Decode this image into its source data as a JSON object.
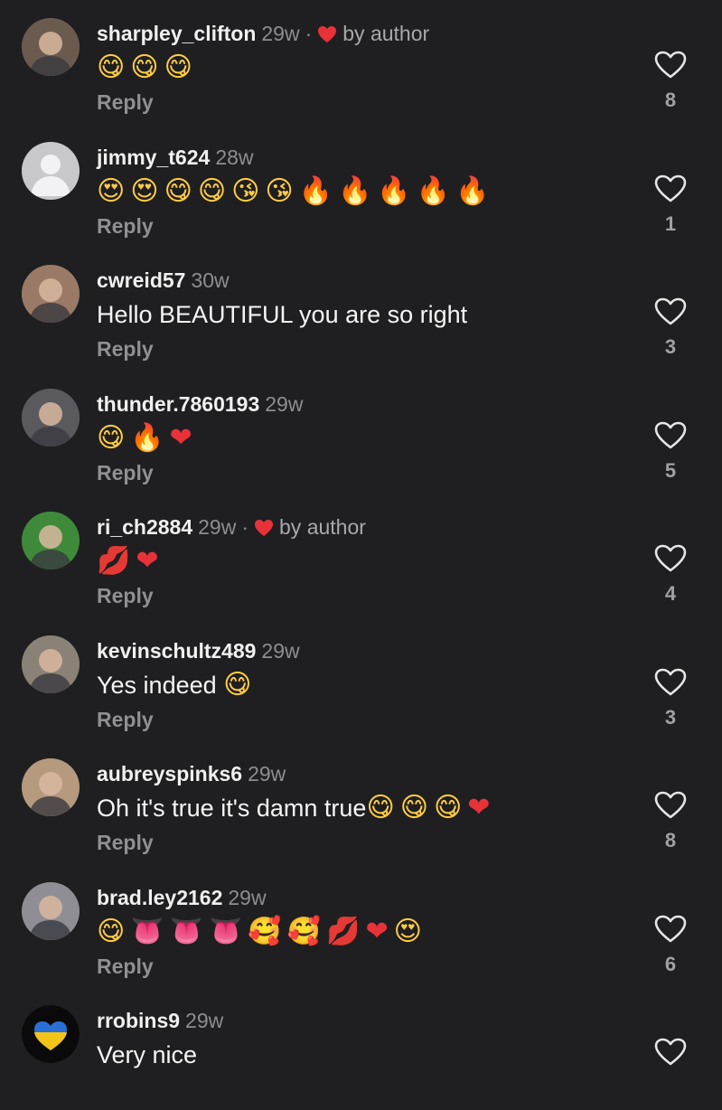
{
  "comments": [
    {
      "username": "sharpley_clifton",
      "time": "29w",
      "liked_by_author": true,
      "by_author_label": "by author",
      "text": "",
      "emojis": [
        {
          "char": "😋",
          "name": "yum-emoji",
          "tone": "yellow"
        },
        {
          "char": "😋",
          "name": "yum-emoji",
          "tone": "yellow"
        },
        {
          "char": "😋",
          "name": "yum-emoji",
          "tone": "yellow"
        }
      ],
      "reply_label": "Reply",
      "likes": "8",
      "avatar_color": "#6b5a4e"
    },
    {
      "username": "jimmy_t624",
      "time": "28w",
      "liked_by_author": false,
      "by_author_label": "",
      "text": "",
      "emojis": [
        {
          "char": "😍",
          "name": "heart-eyes-emoji",
          "tone": "yellow"
        },
        {
          "char": "😍",
          "name": "heart-eyes-emoji",
          "tone": "yellow"
        },
        {
          "char": "😋",
          "name": "yum-emoji",
          "tone": "yellow"
        },
        {
          "char": "😋",
          "name": "yum-emoji",
          "tone": "yellow"
        },
        {
          "char": "😘",
          "name": "kiss-emoji",
          "tone": "yellow"
        },
        {
          "char": "😘",
          "name": "kiss-emoji",
          "tone": "yellow"
        },
        {
          "char": "🔥",
          "name": "fire-emoji",
          "tone": "fire"
        },
        {
          "char": "🔥",
          "name": "fire-emoji",
          "tone": "fire"
        },
        {
          "char": "🔥",
          "name": "fire-emoji",
          "tone": "fire"
        },
        {
          "char": "🔥",
          "name": "fire-emoji",
          "tone": "fire"
        },
        {
          "char": "🔥",
          "name": "fire-emoji",
          "tone": "fire"
        }
      ],
      "reply_label": "Reply",
      "likes": "1",
      "avatar_color": "#c8c8cc"
    },
    {
      "username": "cwreid57",
      "time": "30w",
      "liked_by_author": false,
      "by_author_label": "",
      "text": "Hello BEAUTIFUL you are so right",
      "emojis": [],
      "reply_label": "Reply",
      "likes": "3",
      "avatar_color": "#9a7a66"
    },
    {
      "username": "thunder.7860193",
      "time": "29w",
      "liked_by_author": false,
      "by_author_label": "",
      "text": "",
      "emojis": [
        {
          "char": "😋",
          "name": "yum-emoji",
          "tone": "yellow"
        },
        {
          "char": "🔥",
          "name": "fire-emoji",
          "tone": "fire"
        },
        {
          "char": "❤",
          "name": "red-heart-emoji",
          "tone": "red"
        }
      ],
      "reply_label": "Reply",
      "likes": "5",
      "avatar_color": "#5a5a5e"
    },
    {
      "username": "ri_ch2884",
      "time": "29w",
      "liked_by_author": true,
      "by_author_label": "by author",
      "text": "",
      "emojis": [
        {
          "char": "💋",
          "name": "kiss-mark-emoji",
          "tone": "red"
        },
        {
          "char": "❤",
          "name": "red-heart-emoji",
          "tone": "red"
        }
      ],
      "reply_label": "Reply",
      "likes": "4",
      "avatar_color": "#3f8a3a"
    },
    {
      "username": "kevinschultz489",
      "time": "29w",
      "liked_by_author": false,
      "by_author_label": "",
      "text": "Yes indeed ",
      "emojis": [
        {
          "char": "😋",
          "name": "yum-emoji",
          "tone": "yellow"
        }
      ],
      "reply_label": "Reply",
      "likes": "3",
      "avatar_color": "#8a8276"
    },
    {
      "username": "aubreyspinks6",
      "time": "29w",
      "liked_by_author": false,
      "by_author_label": "",
      "text": "Oh it's true it's damn true",
      "emojis": [
        {
          "char": "😋",
          "name": "yum-emoji",
          "tone": "yellow"
        },
        {
          "char": "😋",
          "name": "yum-emoji",
          "tone": "yellow"
        },
        {
          "char": "😋",
          "name": "yum-emoji",
          "tone": "yellow"
        },
        {
          "char": "❤",
          "name": "red-heart-emoji",
          "tone": "red"
        }
      ],
      "reply_label": "Reply",
      "likes": "8",
      "avatar_color": "#b59a7e"
    },
    {
      "username": "brad.ley2162",
      "time": "29w",
      "liked_by_author": false,
      "by_author_label": "",
      "text": "",
      "emojis": [
        {
          "char": "😋",
          "name": "yum-emoji",
          "tone": "yellow"
        },
        {
          "char": "👅",
          "name": "tongue-emoji",
          "tone": "pink"
        },
        {
          "char": "👅",
          "name": "tongue-emoji",
          "tone": "pink"
        },
        {
          "char": "👅",
          "name": "tongue-emoji",
          "tone": "pink"
        },
        {
          "char": "🥰",
          "name": "smiling-hearts-emoji",
          "tone": "yellow"
        },
        {
          "char": "🥰",
          "name": "smiling-hearts-emoji",
          "tone": "yellow"
        },
        {
          "char": "💋",
          "name": "kiss-mark-emoji",
          "tone": "red"
        },
        {
          "char": "❤",
          "name": "heart-on-fire-emoji",
          "tone": "red"
        },
        {
          "char": "😍",
          "name": "heart-eyes-emoji",
          "tone": "yellow"
        }
      ],
      "reply_label": "Reply",
      "likes": "6",
      "avatar_color": "#8e8e94"
    },
    {
      "username": "rrobins9",
      "time": "29w",
      "liked_by_author": false,
      "by_author_label": "",
      "text": "Very nice",
      "emojis": [],
      "reply_label": "",
      "likes": "",
      "avatar_color": "#0a0a0a"
    }
  ],
  "colors": {
    "background": "#1f1f21",
    "username": "#f0f0f0",
    "muted": "#8d8d92",
    "author_heart": "#e8323a"
  }
}
